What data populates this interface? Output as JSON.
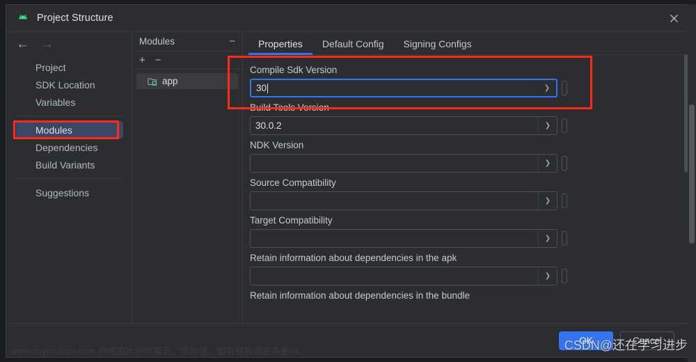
{
  "window": {
    "title": "Project Structure",
    "app_icon": "android-icon",
    "close_icon": "close-icon"
  },
  "nav": {
    "back_icon": "arrow-left-icon",
    "forward_icon": "arrow-right-icon",
    "items": [
      {
        "label": "Project",
        "selected": false
      },
      {
        "label": "SDK Location",
        "selected": false
      },
      {
        "label": "Variables",
        "selected": false
      },
      {
        "label": "Modules",
        "selected": true
      },
      {
        "label": "Dependencies",
        "selected": false
      },
      {
        "label": "Build Variants",
        "selected": false
      },
      {
        "label": "Suggestions",
        "selected": false
      }
    ]
  },
  "modules_panel": {
    "header": "Modules",
    "collapse_icon": "minus-icon",
    "add_icon": "plus-icon",
    "remove_icon": "minus-icon",
    "items": [
      {
        "label": "app",
        "icon": "module-folder-icon",
        "selected": true
      }
    ]
  },
  "tabs": [
    {
      "label": "Properties",
      "active": true
    },
    {
      "label": "Default Config",
      "active": false
    },
    {
      "label": "Signing Configs",
      "active": false
    }
  ],
  "form": {
    "fields": [
      {
        "label": "Compile Sdk Version",
        "value": "30",
        "focused": true,
        "caret": true
      },
      {
        "label": "Build Tools Version",
        "value": "30.0.2",
        "focused": false,
        "caret": false
      },
      {
        "label": "NDK Version",
        "value": "",
        "focused": false,
        "caret": false
      },
      {
        "label": "Source Compatibility",
        "value": "",
        "focused": false,
        "caret": false
      },
      {
        "label": "Target Compatibility",
        "value": "",
        "focused": false,
        "caret": false
      },
      {
        "label": "Retain information about dependencies in the apk",
        "value": "",
        "focused": false,
        "caret": false
      }
    ],
    "truncated_label": "Retain information about dependencies in the bundle",
    "dropdown_icon": "chevron-down-icon",
    "variable_button_icon": "variable-pill-icon"
  },
  "buttons": {
    "ok": "OK",
    "cancel": "Cancel"
  },
  "watermarks": {
    "bottom": "www.toymoban.com 网络图片仅供展示，非存储，如有侵权请联系删除。",
    "csdn": "CSDN@还在学习进步"
  },
  "colors": {
    "accent_blue": "#3574f0",
    "annotation_red": "#ff2a17",
    "selection_blue": "#3a4764",
    "window_bg": "#2b2d30",
    "module_green": "#3ddc84"
  }
}
